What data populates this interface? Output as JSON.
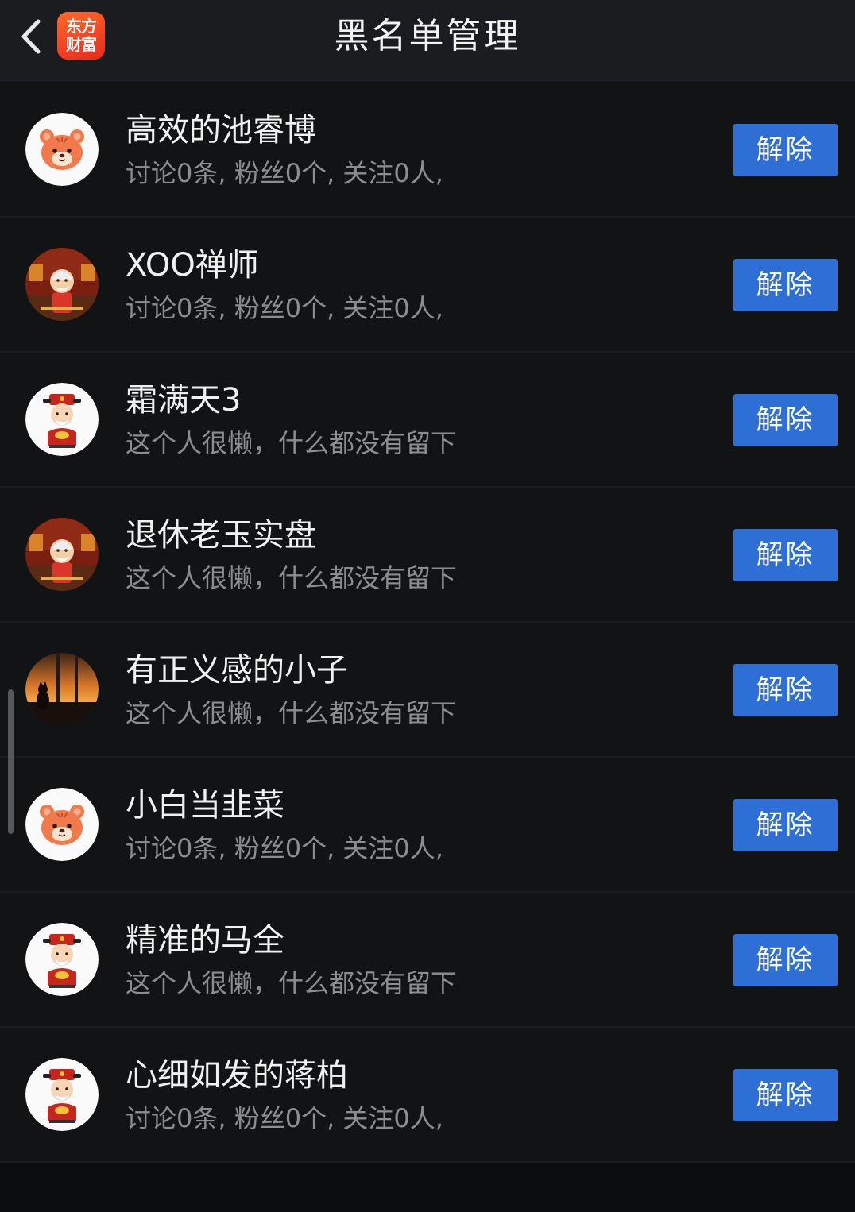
{
  "header": {
    "title": "黑名单管理",
    "back_icon": "chevron-left-icon",
    "logo_line1": "东方",
    "logo_line2": "财富"
  },
  "colors": {
    "header_bg": "#1b1c1f",
    "list_bg": "#121315",
    "button_bg": "#2e6fd6",
    "name_text": "#f0f0f0",
    "desc_text": "#8c8d90",
    "logo_bg": "#e8291e"
  },
  "users": [
    {
      "name": "高效的池睿博",
      "desc": "讨论0条, 粉丝0个, 关注0人,",
      "avatar": "tiger-avatar",
      "action": "解除"
    },
    {
      "name": "XOO禅师",
      "desc": "讨论0条, 粉丝0个, 关注0人,",
      "avatar": "old-man-avatar",
      "action": "解除"
    },
    {
      "name": "霜满天3",
      "desc": "这个人很懒，什么都没有留下",
      "avatar": "fortune-god-avatar",
      "action": "解除"
    },
    {
      "name": "退休老玉实盘",
      "desc": "这个人很懒，什么都没有留下",
      "avatar": "old-man-avatar",
      "action": "解除"
    },
    {
      "name": "有正义感的小子",
      "desc": "这个人很懒，什么都没有留下",
      "avatar": "sunset-cat-avatar",
      "action": "解除"
    },
    {
      "name": "小白当韭菜",
      "desc": "讨论0条, 粉丝0个, 关注0人,",
      "avatar": "tiger-avatar",
      "action": "解除"
    },
    {
      "name": "精准的马全",
      "desc": "这个人很懒，什么都没有留下",
      "avatar": "fortune-god-avatar",
      "action": "解除"
    },
    {
      "name": "心细如发的蒋柏",
      "desc": "讨论0条, 粉丝0个, 关注0人,",
      "avatar": "fortune-god-avatar",
      "action": "解除"
    }
  ]
}
